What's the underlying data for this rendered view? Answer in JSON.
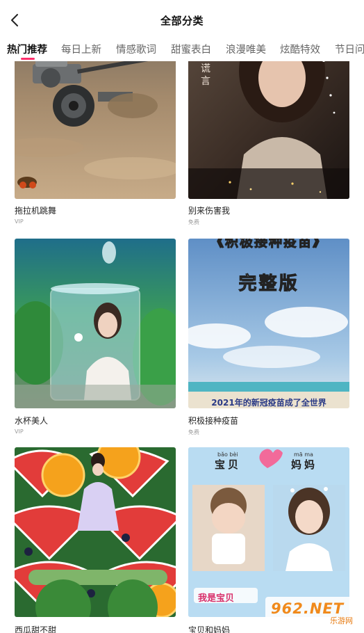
{
  "header": {
    "title": "全部分类"
  },
  "tabs": [
    "热门推荐",
    "每日上新",
    "情感歌词",
    "甜蜜表白",
    "浪漫唯美",
    "炫酷特效",
    "节日问"
  ],
  "cards": [
    {
      "name": "拖拉机跳舞",
      "badge": "VIP"
    },
    {
      "name": "别来伤害我",
      "badge": "免费",
      "overlay_text": "用你的谎言"
    },
    {
      "name": "水杯美人",
      "badge": "VIP"
    },
    {
      "name": "积极接种疫苗",
      "badge": "免费",
      "overlay_top": "《积极接种疫苗》",
      "overlay_mid": "完整版",
      "overlay_bottom": "2021年的新冠疫苗成了全世界"
    },
    {
      "name": "西瓜甜不甜",
      "badge": ""
    },
    {
      "name": "宝贝和妈妈",
      "badge": "",
      "overlay_left": "宝贝",
      "overlay_right": "妈妈",
      "pinyin_left": "bǎo bèi",
      "pinyin_right": "mā ma",
      "overlay_caption": "我是宝贝"
    }
  ],
  "watermark": {
    "logo": "962.NET",
    "sub": "乐游网"
  },
  "colors": {
    "accent": "#ff2f6d",
    "watermark": "#f08a1c"
  },
  "icons": {
    "back": "back-arrow-icon"
  }
}
